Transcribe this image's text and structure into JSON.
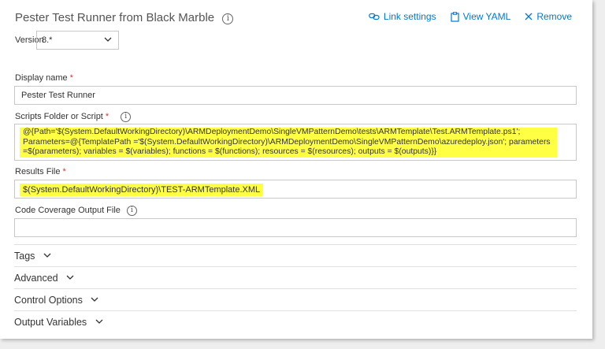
{
  "header": {
    "title": "Pester Test Runner from Black Marble",
    "info_icon": "info-icon",
    "actions": [
      {
        "label": "Link settings",
        "icon": "link-icon"
      },
      {
        "label": "View YAML",
        "icon": "clipboard-icon"
      },
      {
        "label": "Remove",
        "icon": "close-icon"
      }
    ]
  },
  "version": {
    "label": "Version",
    "value": "8.*"
  },
  "display_name": {
    "label": "Display name",
    "required": "*",
    "value": "Pester Test Runner"
  },
  "scripts": {
    "label": "Scripts Folder or Script",
    "required": "*",
    "lines": [
      "@{Path='$(System.DefaultWorkingDirectory)\\ARMDeploymentDemo\\SingleVMPatternDemo\\tests\\ARMTemplate\\Test.ARMTemplate.ps1';",
      "Parameters=@{TemplatePath ='$(System.DefaultWorkingDirectory)\\ARMDeploymentDemo\\SingleVMPatternDemo\\azuredeploy.json'; parameters",
      "=$(parameters); variables = $(variables); functions = $(functions); resources = $(resources); outputs = $(outputs)}}"
    ]
  },
  "results_file": {
    "label": "Results File",
    "required": "*",
    "value": "$(System.DefaultWorkingDirectory)\\TEST-ARMTemplate.XML"
  },
  "code_coverage": {
    "label": "Code Coverage Output File",
    "value": ""
  },
  "sections": [
    "Tags",
    "Advanced",
    "Control Options",
    "Output Variables"
  ],
  "colors": {
    "accent": "#0078d4",
    "required": "#d13438",
    "highlight": "#ffff44"
  }
}
